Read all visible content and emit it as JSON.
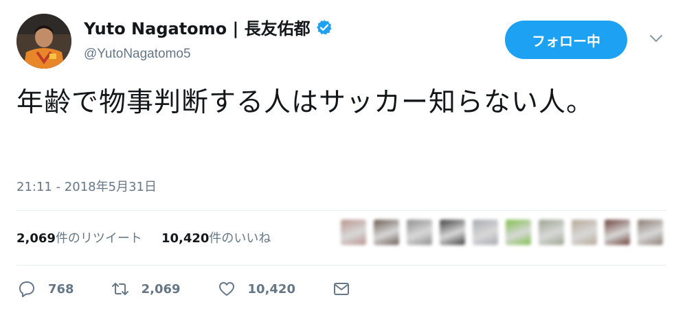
{
  "user": {
    "display_name": "Yuto Nagatomo | 長友佑都",
    "handle": "@YutoNagatomo5",
    "verified_icon": "verified-badge-icon"
  },
  "follow_button": {
    "label": "フォロー中"
  },
  "tweet": {
    "text": "年齢で物事判断する人はサッカー知らない人。",
    "timestamp": "21:11 - 2018年5月31日"
  },
  "stats": {
    "retweets": {
      "count": "2,069",
      "label": "件のリツイート"
    },
    "likes": {
      "count": "10,420",
      "label": "件のいいね"
    }
  },
  "liker_avatars": [
    {
      "color": "#b9948f"
    },
    {
      "color": "#6a5a52"
    },
    {
      "color": "#8d8d8d"
    },
    {
      "color": "#3d3d3d"
    },
    {
      "color": "#a7aab0"
    },
    {
      "color": "#7fbf4a"
    },
    {
      "color": "#9aa38e"
    },
    {
      "color": "#b7a898"
    },
    {
      "color": "#6a3f38"
    },
    {
      "color": "#8a7a72"
    }
  ],
  "actions": {
    "reply": {
      "icon": "reply-icon",
      "count": "768"
    },
    "retweet": {
      "icon": "retweet-icon",
      "count": "2,069"
    },
    "like": {
      "icon": "heart-icon",
      "count": "10,420"
    },
    "message": {
      "icon": "envelope-icon"
    }
  },
  "colors": {
    "accent": "#1da1f2",
    "secondary_text": "#657786",
    "divider": "#e6ecf0"
  }
}
